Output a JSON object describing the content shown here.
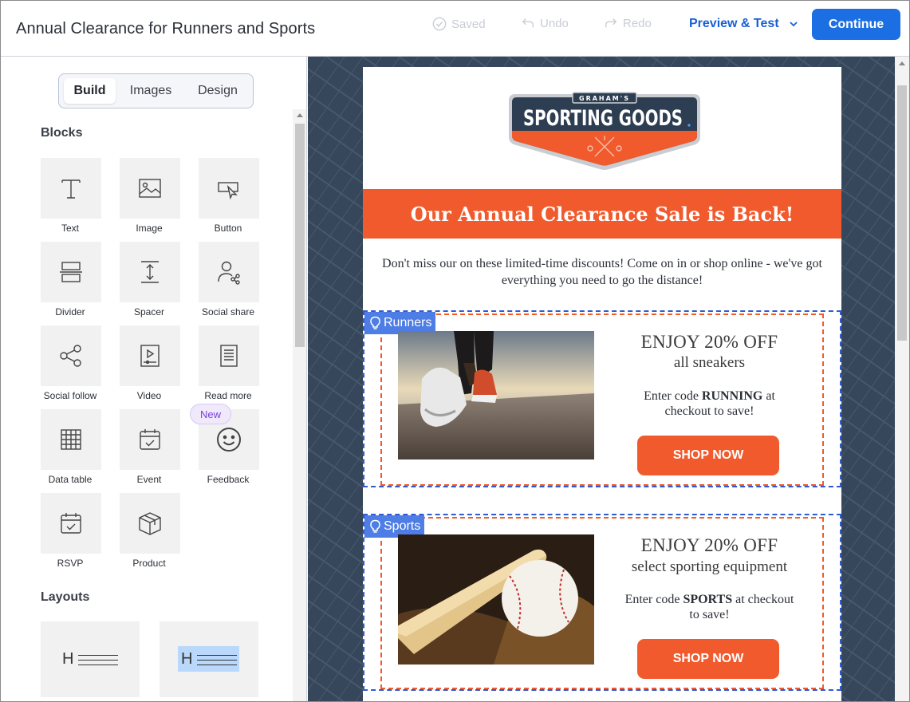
{
  "header": {
    "title": "Annual Clearance for Runners and Sports",
    "saved_label": "Saved",
    "undo_label": "Undo",
    "redo_label": "Redo",
    "preview_label": "Preview & Test",
    "continue_label": "Continue"
  },
  "sidebar": {
    "tabs": [
      "Build",
      "Images",
      "Design"
    ],
    "active_tab": "Build",
    "blocks_title": "Blocks",
    "blocks": [
      {
        "label": "Text",
        "icon": "text-icon"
      },
      {
        "label": "Image",
        "icon": "image-icon"
      },
      {
        "label": "Button",
        "icon": "button-icon"
      },
      {
        "label": "Divider",
        "icon": "divider-icon"
      },
      {
        "label": "Spacer",
        "icon": "spacer-icon"
      },
      {
        "label": "Social share",
        "icon": "social-share-icon"
      },
      {
        "label": "Social follow",
        "icon": "social-follow-icon"
      },
      {
        "label": "Video",
        "icon": "video-icon"
      },
      {
        "label": "Read more",
        "icon": "read-more-icon"
      },
      {
        "label": "Data table",
        "icon": "data-table-icon"
      },
      {
        "label": "Event",
        "icon": "event-icon"
      },
      {
        "label": "Feedback",
        "icon": "feedback-icon"
      },
      {
        "label": "RSVP",
        "icon": "rsvp-icon"
      },
      {
        "label": "Product",
        "icon": "product-icon"
      }
    ],
    "new_badge": "New",
    "layouts_title": "Layouts",
    "layout_glyph": "H"
  },
  "email": {
    "logo_top": "GRAHAM'S",
    "logo_main": "SPORTING GOODS",
    "banner": "Our Annual Clearance Sale is Back!",
    "intro": "Don't miss our on these limited-time discounts! Come on in or shop online - we've got everything you need to go the distance!",
    "sections": [
      {
        "tag": "Runners",
        "headline": "ENJOY 20% OFF",
        "subline": "all sneakers",
        "code_prefix": "Enter code",
        "code": "RUNNING",
        "code_suffix": "at checkout to save!",
        "button": "SHOP NOW"
      },
      {
        "tag": "Sports",
        "headline": "ENJOY 20% OFF",
        "subline": "select sporting equipment",
        "code_prefix": "Enter code",
        "code": "SPORTS",
        "code_suffix": "at checkout to save!",
        "button": "SHOP NOW"
      }
    ]
  },
  "colors": {
    "accent_blue": "#1b6fe3",
    "brand_orange": "#f05a2c",
    "canvas_bg": "#37475b",
    "section_outline": "#2f5bd1"
  }
}
